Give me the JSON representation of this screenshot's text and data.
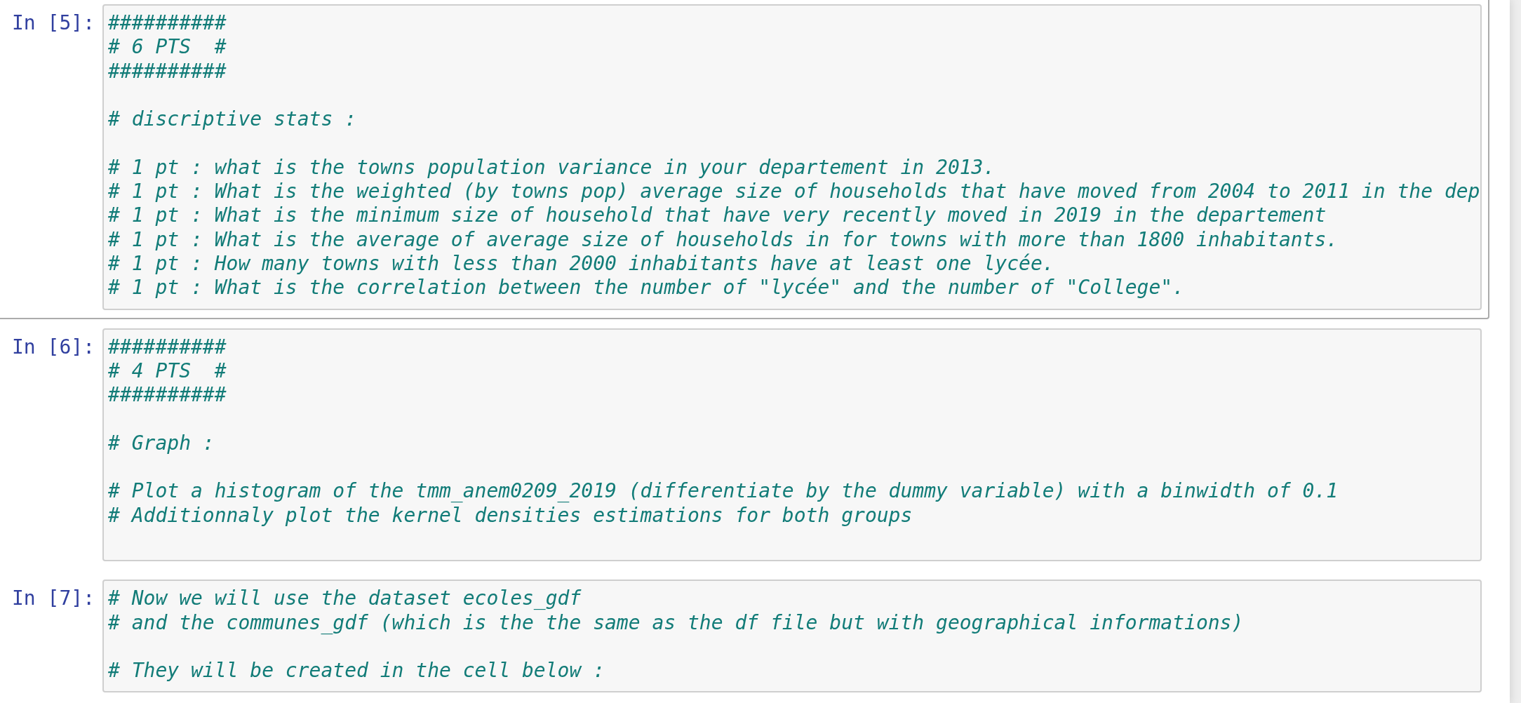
{
  "notebook": {
    "cells": [
      {
        "prompt": "In [5]:",
        "selected": true,
        "trailing_blank_line": false,
        "blocks": [
          [
            "##########",
            "# 6 PTS  #",
            "##########"
          ],
          [
            "# discriptive stats :"
          ],
          [
            "# 1 pt : what is the towns population variance in your departement in 2013.",
            "# 1 pt : What is the weighted (by towns pop) average size of households that have moved from 2004 to 2011 in the dep",
            "# 1 pt : What is the minimum size of household that have very recently moved in 2019 in the departement",
            "# 1 pt : What is the average of average size of households in for towns with more than 1800 inhabitants.",
            "# 1 pt : How many towns with less than 2000 inhabitants have at least one lycée.",
            "# 1 pt : What is the correlation between the number of \"lycée\" and the number of \"College\"."
          ]
        ]
      },
      {
        "prompt": "In [6]:",
        "selected": false,
        "trailing_blank_line": true,
        "blocks": [
          [
            "##########",
            "# 4 PTS  #",
            "##########"
          ],
          [
            "# Graph :"
          ],
          [
            "# Plot a histogram of the tmm_anem0209_2019 (differentiate by the dummy variable) with a binwidth of 0.1",
            "# Additionnaly plot the kernel densities estimations for both groups"
          ]
        ]
      },
      {
        "prompt": "In [7]:",
        "selected": false,
        "trailing_blank_line": false,
        "blocks": [
          [
            "# Now we will use the dataset ecoles_gdf",
            "# and the communes_gdf (which is the the same as the df file but with geographical informations)"
          ],
          [
            "# They will be created in the cell below :"
          ]
        ]
      }
    ]
  }
}
